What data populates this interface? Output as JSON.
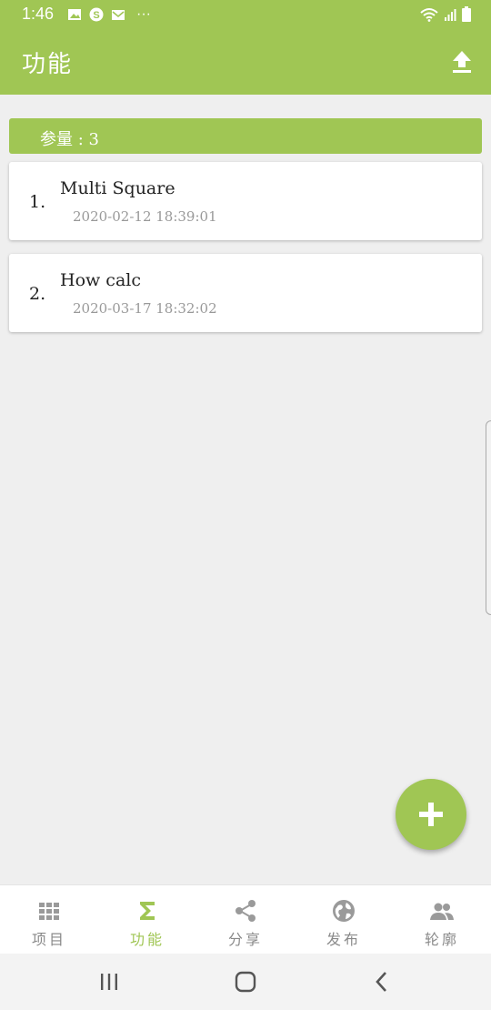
{
  "status": {
    "time": "1:46",
    "more": "···",
    "left_icons": [
      "image-icon",
      "skype-icon",
      "mail-icon"
    ],
    "right_icons": [
      "wifi-icon",
      "signal-icon",
      "battery-icon"
    ]
  },
  "appbar": {
    "title": "功能",
    "action_icon": "upload-icon"
  },
  "list": {
    "count_label": "参量 : 3",
    "items": [
      {
        "index": "1.",
        "title": "Multi Square",
        "date": "2020-02-12 18:39:01"
      },
      {
        "index": "2.",
        "title": "How calc",
        "date": "2020-03-17 18:32:02"
      }
    ]
  },
  "fab": {
    "icon": "plus-icon"
  },
  "bottom_nav": {
    "active_index": 1,
    "items": [
      {
        "label": "项目",
        "icon": "grid-icon"
      },
      {
        "label": "功能",
        "icon": "sigma-icon"
      },
      {
        "label": "分享",
        "icon": "share-icon"
      },
      {
        "label": "发布",
        "icon": "globe-icon"
      },
      {
        "label": "轮廓",
        "icon": "people-icon"
      }
    ]
  },
  "system_nav": [
    "recents-icon",
    "home-icon",
    "back-icon"
  ],
  "colors": {
    "accent": "#a0c654",
    "background": "#efefef",
    "nav_inactive": "#8a8a8a"
  }
}
